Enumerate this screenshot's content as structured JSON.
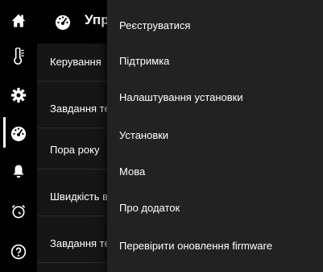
{
  "sidebar": {
    "items": [
      {
        "icon": "home-icon",
        "active": false
      },
      {
        "icon": "thermometer-icon",
        "active": false
      },
      {
        "icon": "gear-icon",
        "active": false
      },
      {
        "icon": "speedometer-icon",
        "active": true
      },
      {
        "icon": "bell-icon",
        "active": false
      },
      {
        "icon": "timer-icon",
        "active": false
      },
      {
        "icon": "help-circle-icon",
        "active": false
      }
    ]
  },
  "header": {
    "title": "Упра",
    "icon": "speedometer-icon"
  },
  "main": {
    "rows": [
      {
        "label": "Керування"
      },
      {
        "label": "Завдання те"
      },
      {
        "label": "Пора року"
      },
      {
        "label": "Швидкість в"
      },
      {
        "label": "Завдання те"
      }
    ]
  },
  "menu": {
    "items": [
      {
        "label": "Реєструватися"
      },
      {
        "label": "Підтримка"
      },
      {
        "label": "Налаштування установки"
      },
      {
        "label": "Установки"
      },
      {
        "label": "Мова"
      },
      {
        "label": "Про додаток"
      },
      {
        "label": "Перевірити оновлення firmware"
      }
    ]
  },
  "colors": {
    "background": "#000000",
    "list_background": "#161616",
    "menu_background": "#222222",
    "text": "#ffffff"
  }
}
